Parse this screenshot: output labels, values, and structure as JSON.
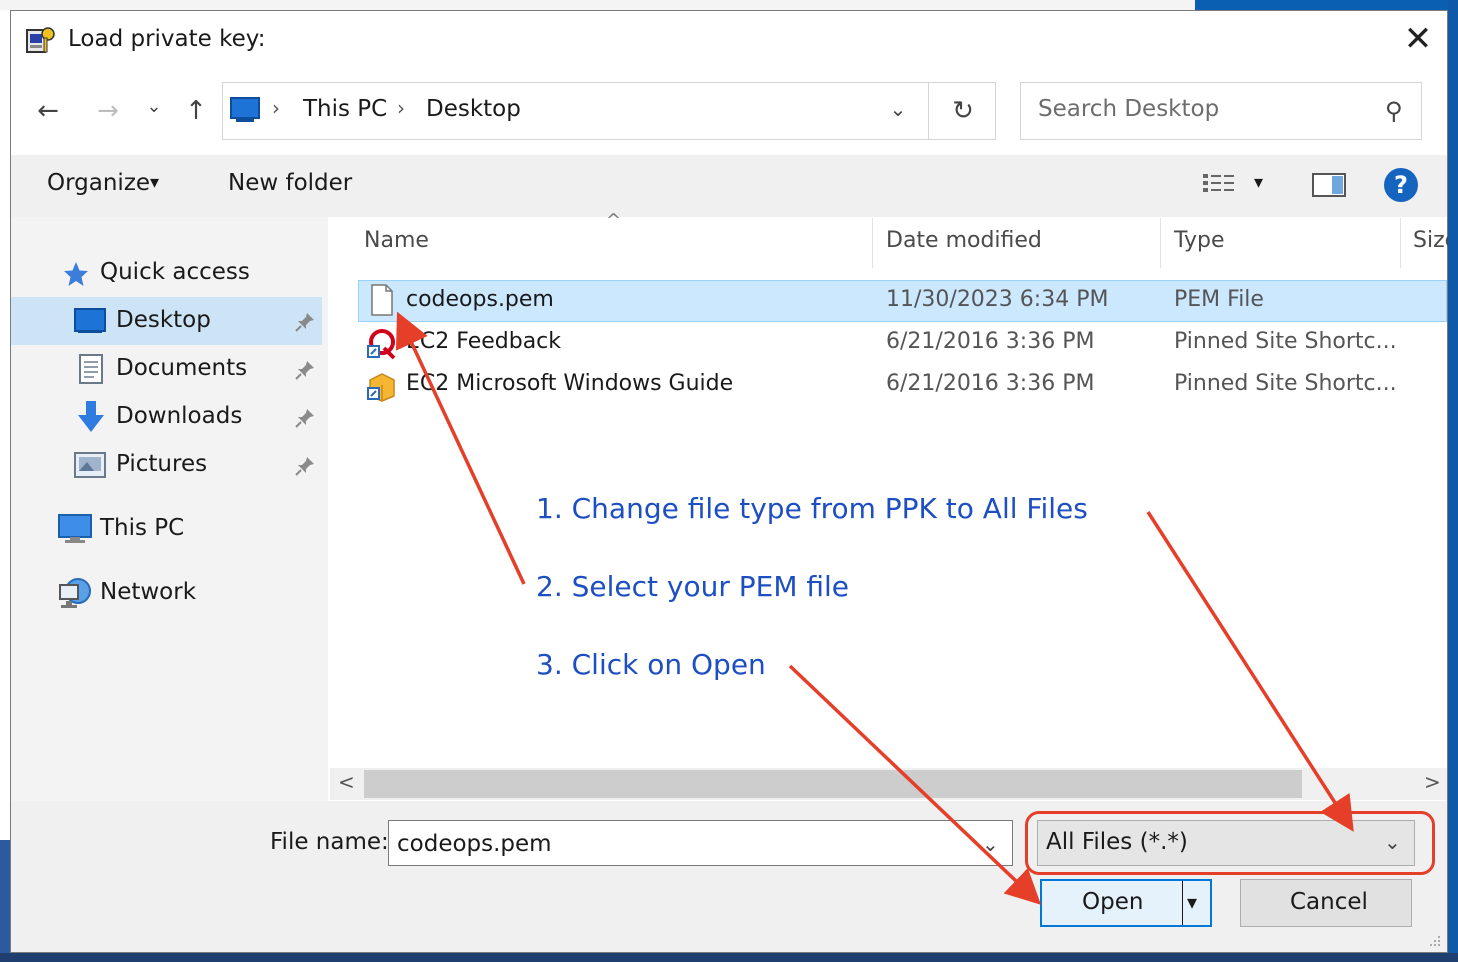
{
  "dialog": {
    "title": "Load private key:",
    "close_glyph": "✕"
  },
  "navigation": {
    "back_glyph": "←",
    "forward_glyph": "→",
    "recent_glyph": "⌄",
    "up_glyph": "↑",
    "breadcrumb": [
      "This PC",
      "Desktop"
    ],
    "breadcrumb_sep": "›",
    "refresh_glyph": "↻",
    "dropdown_glyph": "⌄",
    "search_placeholder": "Search Desktop",
    "search_glyph": "⚲"
  },
  "toolbar": {
    "organize_label": "Organize",
    "new_folder_label": "New folder",
    "caret_glyph": "▾",
    "help_glyph": "?"
  },
  "sidebar": {
    "items": [
      {
        "label": "Quick access",
        "icon": "star-icon"
      },
      {
        "label": "Desktop",
        "icon": "desktop-icon",
        "pinned": true,
        "selected": true
      },
      {
        "label": "Documents",
        "icon": "documents-icon",
        "pinned": true
      },
      {
        "label": "Downloads",
        "icon": "downloads-icon",
        "pinned": true
      },
      {
        "label": "Pictures",
        "icon": "pictures-icon",
        "pinned": true
      },
      {
        "label": "This PC",
        "icon": "computer-icon"
      },
      {
        "label": "Network",
        "icon": "network-icon"
      }
    ],
    "pin_glyph": "📌"
  },
  "file_list": {
    "sort_glyph": "^",
    "columns": [
      "Name",
      "Date modified",
      "Type",
      "Size"
    ],
    "rows": [
      {
        "name": "codeops.pem",
        "date": "11/30/2023 6:34 PM",
        "type": "PEM File",
        "selected": true
      },
      {
        "name": "EC2 Feedback",
        "date": "6/21/2016 3:36 PM",
        "type": "Pinned Site Shortc..."
      },
      {
        "name": "EC2 Microsoft Windows Guide",
        "date": "6/21/2016 3:36 PM",
        "type": "Pinned Site Shortc..."
      }
    ],
    "scroll_left_glyph": "<",
    "scroll_right_glyph": ">"
  },
  "footer": {
    "file_name_label": "File name:",
    "file_name_value": "codeops.pem",
    "file_type_value": "All Files (*.*)",
    "open_label": "Open",
    "cancel_label": "Cancel"
  },
  "annotations": [
    "1. Change file type from PPK to All Files",
    "2. Select your PEM file",
    "3. Click on Open"
  ],
  "colors": {
    "annotation_text": "#1e4fc2",
    "annotation_arrow": "#e53f2a",
    "selection": "#cce8ff",
    "accent": "#0078d7"
  }
}
